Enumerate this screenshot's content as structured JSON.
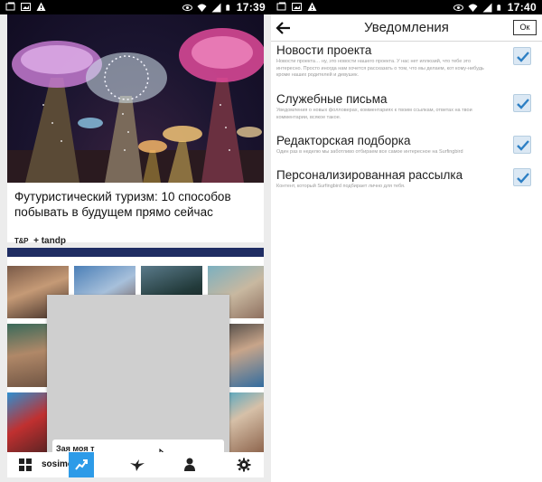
{
  "left": {
    "status_time": "17:39",
    "article": {
      "title": "Футуристический туризм: 10 способов побывать в будущем прямо сейчас",
      "source_logo": "T&P",
      "source_name": "+ tandp"
    },
    "gallery": {
      "popup_input_text": "Зая моя т"
    },
    "nav": {
      "user_label": "sosimc"
    }
  },
  "right": {
    "status_time": "17:40",
    "title": "Уведомления",
    "ok_label": "Ок",
    "settings": [
      {
        "title": "Новости проекта",
        "description": "Новости проекта… ну, это новости нашего проекта. У нас нет иллюзий, что тебе это интересно. Просто иногда нам хочется рассказать о том, что мы делаем, кот кому-нибудь кроме наших родителей и девушек.",
        "checked": true
      },
      {
        "title": "Служебные письма",
        "description": "Уведомления о новых фолловерах, комментариях к твоим ссылкам, ответах на твои комментарии, всякое такое.",
        "checked": true
      },
      {
        "title": "Редакторская подборка",
        "description": "Один раз в неделю мы заботливо отбираем все самое интересное на Surfingbird",
        "checked": true
      },
      {
        "title": "Персонализированная рассылка",
        "description": "Контент, который Surfingbird подбирает лично для тебя.",
        "checked": true
      }
    ]
  },
  "icons": {
    "left_status": [
      "gallery-icon",
      "image-icon",
      "warning-icon"
    ],
    "right_status": [
      "gallery-icon",
      "image-icon",
      "warning-icon"
    ],
    "status_right": [
      "eye-icon",
      "wifi-icon",
      "signal-icon",
      "battery-icon"
    ],
    "nav": [
      "grid-icon",
      "trending-icon",
      "bird-icon",
      "person-icon",
      "gear-icon"
    ]
  },
  "colors": {
    "accent_blue": "#2d9be8",
    "checkbox_fill": "#dbe8f4",
    "checkmark": "#2d7fc4",
    "gallery_bar": "#1f2d63"
  }
}
